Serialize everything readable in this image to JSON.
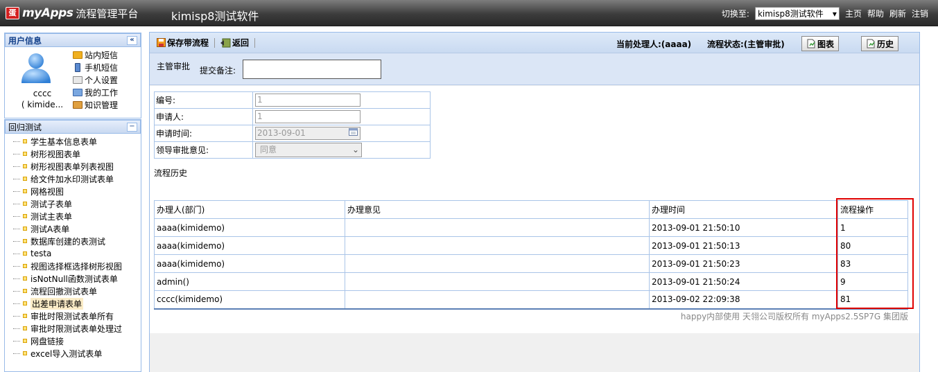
{
  "header": {
    "logo_mark": "蛋",
    "logo_text": "myApps",
    "logo_sub": "流程管理平台",
    "app_title": "kimisp8测试软件",
    "switch_label": "切换至:",
    "switch_value": "kimisp8测试软件",
    "links": [
      "主页",
      "帮助",
      "刷新",
      "注销"
    ]
  },
  "user_panel": {
    "title": "用户信息",
    "collapse": "«",
    "name": "cccc",
    "dept": "( kimide...",
    "links": [
      "站内短信",
      "手机短信",
      "个人设置",
      "我的工作",
      "知识管理"
    ]
  },
  "tree_panel": {
    "title": "回归测试",
    "collapse": "−",
    "items": [
      "学生基本信息表单",
      "树形视图表单",
      "树形视图表单列表视图",
      "给文件加水印测试表单",
      "网格视图",
      "测试子表单",
      "测试主表单",
      "测试A表单",
      "数据库创建的表测试",
      "testa",
      "视图选择框选择树形视图",
      "isNotNull函数测试表单",
      "流程回撤测试表单",
      "出差申请表单",
      "审批时限测试表单所有",
      "审批时限测试表单处理过",
      "网盘链接",
      "excel导入测试表单"
    ]
  },
  "toolbar": {
    "save_flow": "保存带流程",
    "back": "返回",
    "current_handler": "当前处理人:(aaaa)",
    "flow_status": "流程状态:(主管审批)",
    "chart": "图表",
    "history": "历史"
  },
  "note_bar": {
    "node": "主管审批",
    "label": "提交备注:"
  },
  "form": {
    "rows": [
      {
        "label": "编号:",
        "value": "1"
      },
      {
        "label": "申请人:",
        "value": "1"
      },
      {
        "label": "申请时间:",
        "value": "2013-09-01"
      },
      {
        "label": "领导审批意见:",
        "value": "同意"
      }
    ]
  },
  "history": {
    "title": "流程历史",
    "headers": [
      "办理人(部门)",
      "办理意见",
      "办理时间",
      "流程操作"
    ],
    "rows": [
      [
        "aaaa(kimidemo)",
        "",
        "2013-09-01 21:50:10",
        "1"
      ],
      [
        "aaaa(kimidemo)",
        "",
        "2013-09-01 21:50:13",
        "80"
      ],
      [
        "aaaa(kimidemo)",
        "",
        "2013-09-01 21:50:23",
        "83"
      ],
      [
        "admin()",
        "",
        "2013-09-01 21:50:24",
        "9"
      ],
      [
        "cccc(kimidemo)",
        "",
        "2013-09-02 22:09:38",
        "81"
      ]
    ]
  },
  "footer": "happy内部使用  天翎公司版权所有  myApps2.5SP7G 集团版"
}
